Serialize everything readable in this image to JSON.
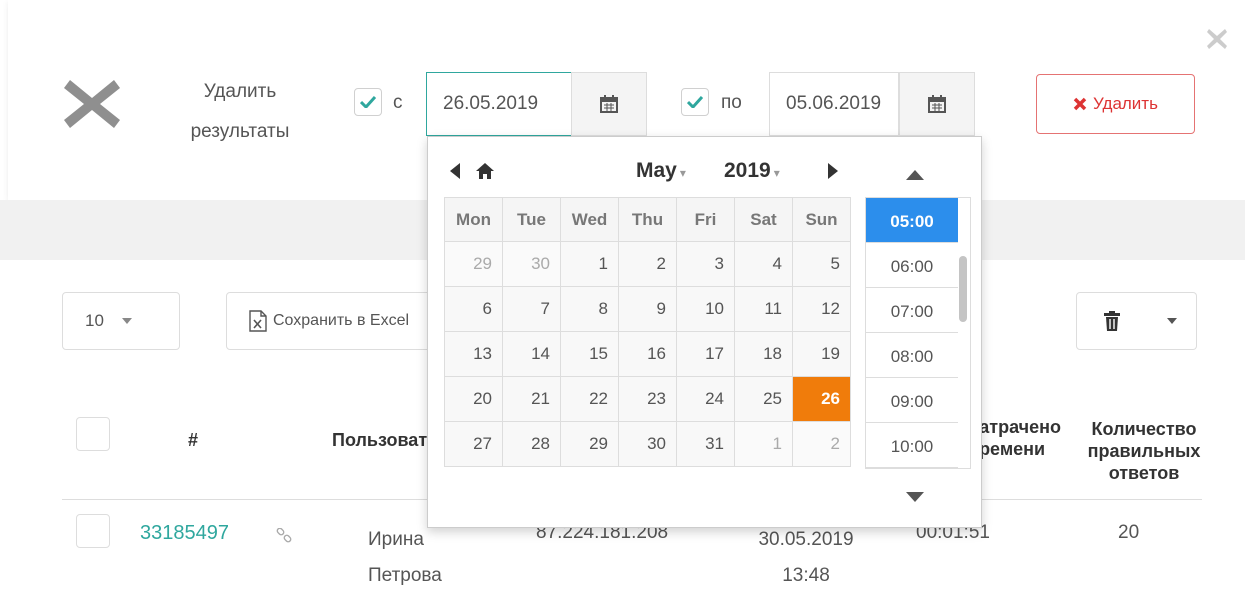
{
  "header": {
    "delete_title": "Удалить результаты",
    "from_label": "с",
    "to_label": "по",
    "from_value": "26.05.2019",
    "to_value": "05.06.2019",
    "delete_button": "Удалить",
    "from_checked": true,
    "to_checked": true
  },
  "toolbar": {
    "page_size": "10",
    "excel_label": "Сохранить в Excel"
  },
  "table": {
    "headers": {
      "num": "#",
      "user": "Пользователь",
      "time_line1": "Затрачено",
      "time_line2": "времени",
      "count_line1": "Количество",
      "count_line2": "правильных",
      "count_line3": "ответов"
    },
    "rows": [
      {
        "id": "33185497",
        "name_line1": "Ирина",
        "name_line2": "Петрова",
        "ip": "87.224.181.208",
        "date_line1": "30.05.2019",
        "date_line2": "13:48",
        "duration": "00:01:51",
        "correct": "20"
      }
    ]
  },
  "datepicker": {
    "month": "May",
    "year": "2019",
    "weekdays": [
      "Mon",
      "Tue",
      "Wed",
      "Thu",
      "Fri",
      "Sat",
      "Sun"
    ],
    "weeks": [
      [
        "29",
        "30",
        "1",
        "2",
        "3",
        "4",
        "5"
      ],
      [
        "6",
        "7",
        "8",
        "9",
        "10",
        "11",
        "12"
      ],
      [
        "13",
        "14",
        "15",
        "16",
        "17",
        "18",
        "19"
      ],
      [
        "20",
        "21",
        "22",
        "23",
        "24",
        "25",
        "26"
      ],
      [
        "27",
        "28",
        "29",
        "30",
        "31",
        "1",
        "2"
      ]
    ],
    "selected_day": "26",
    "times": [
      "05:00",
      "06:00",
      "07:00",
      "08:00",
      "09:00",
      "10:00"
    ],
    "selected_time": "05:00"
  },
  "colors": {
    "accent": "#2fa79e",
    "danger": "#d33333",
    "selected_day": "#f07c0b",
    "selected_time": "#2c8eec"
  }
}
